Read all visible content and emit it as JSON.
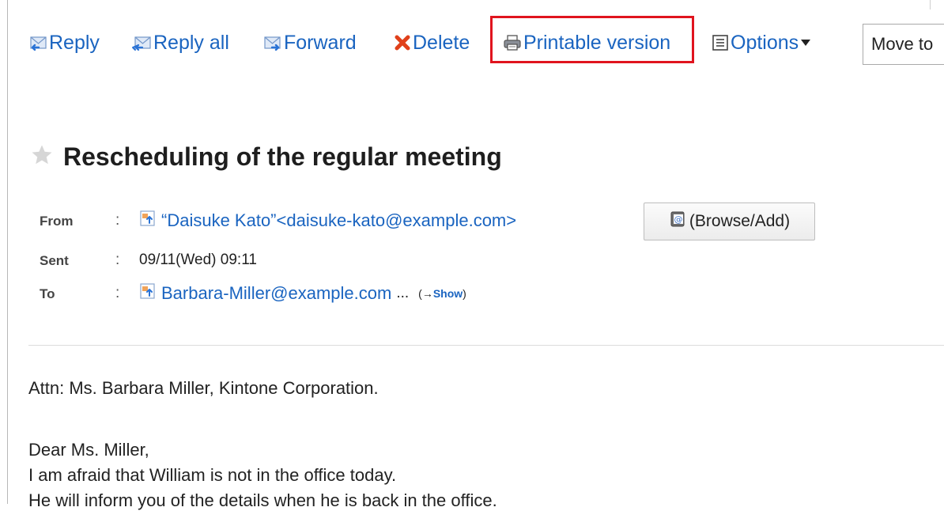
{
  "toolbar": {
    "reply_label": "Reply",
    "reply_all_label": "Reply all",
    "forward_label": "Forward",
    "delete_label": "Delete",
    "printable_label": "Printable version",
    "options_label": "Options",
    "move_to_label": "Move to"
  },
  "message": {
    "subject": "Rescheduling of the regular meeting",
    "from_label": "From",
    "from_value": "“Daisuke Kato”<daisuke-kato@example.com>",
    "browse_add_label": "(Browse/Add)",
    "sent_label": "Sent",
    "sent_value": "09/11(Wed) 09:11",
    "to_label": "To",
    "to_value": "Barbara-Miller@example.com",
    "to_ellipsis": "...",
    "show_prefix": "(→",
    "show_label": "Show",
    "show_suffix": ")",
    "colon": ":"
  },
  "body_lines": [
    "Attn: Ms. Barbara Miller, Kintone Corporation.",
    "Dear Ms. Miller,",
    "I am afraid that William is not in the office today.",
    "He will inform you of the details when he is back in the office."
  ],
  "icons": {
    "reply": "reply-icon",
    "reply_all": "reply-all-icon",
    "forward": "forward-icon",
    "delete": "delete-icon",
    "print": "printer-icon",
    "options": "list-icon",
    "star": "star-icon",
    "contact": "contact-icon",
    "address_book": "address-book-icon"
  },
  "colors": {
    "link": "#1a64c0",
    "highlight_border": "#e0141e",
    "delete_x": "#e0401a"
  }
}
